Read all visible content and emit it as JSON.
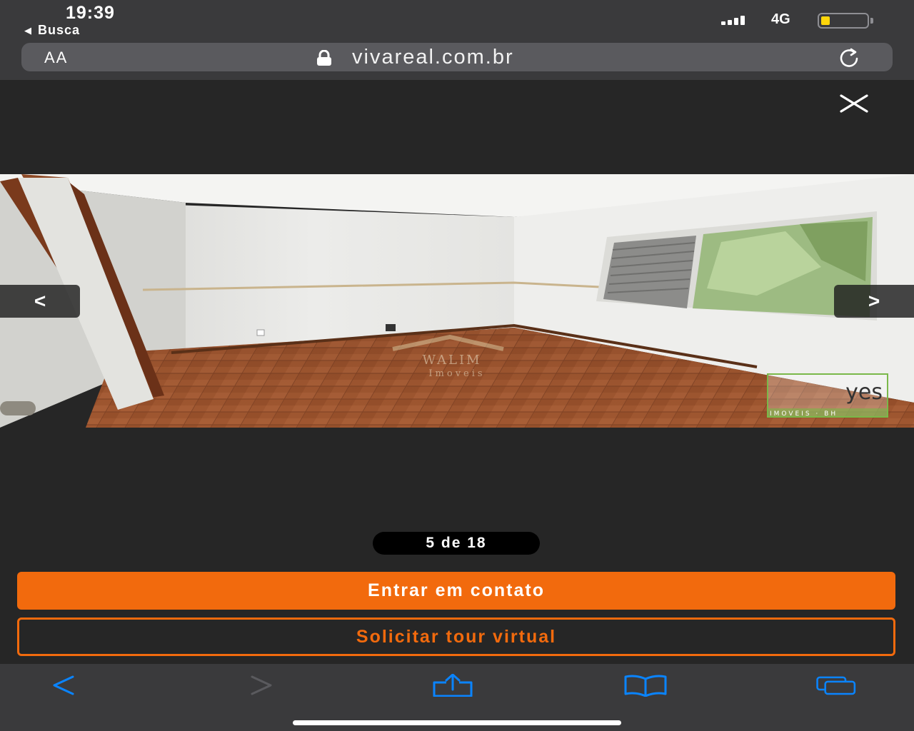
{
  "status_bar": {
    "time": "19:39",
    "back_label": "Busca",
    "network": "4G",
    "battery_level": 0.2,
    "battery_color": "#ffd60a"
  },
  "browser": {
    "text_size_label": "AA",
    "url": "vivareal.com.br"
  },
  "gallery": {
    "counter": "5 de 18",
    "prev_glyph": "<",
    "next_glyph": ">",
    "watermark_walim_line1": "WALIM",
    "watermark_walim_line2": "Imoveis",
    "watermark_yes_logo": "yes",
    "watermark_yes_sub": "IMOVEIS · BH"
  },
  "actions": {
    "contact_label": "Entrar em contato",
    "tour_label": "Solicitar tour virtual",
    "accent_color": "#f26a0d"
  },
  "toolbar": {
    "icons": [
      "back-icon",
      "forward-icon",
      "share-icon",
      "bookmarks-icon",
      "tabs-icon"
    ],
    "icon_color": "#0a84ff"
  }
}
